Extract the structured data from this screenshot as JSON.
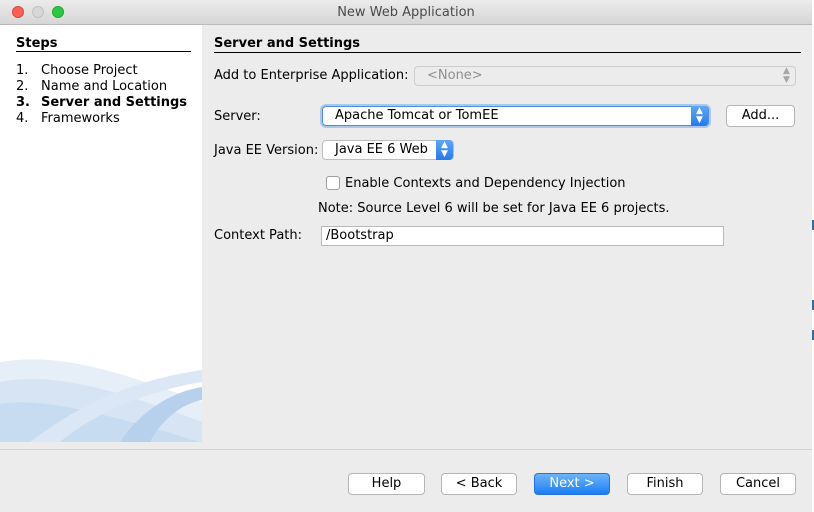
{
  "window": {
    "title": "New Web Application"
  },
  "steps": {
    "heading": "Steps",
    "items": [
      {
        "num": "1.",
        "label": "Choose Project",
        "active": false
      },
      {
        "num": "2.",
        "label": "Name and Location",
        "active": false
      },
      {
        "num": "3.",
        "label": "Server and Settings",
        "active": true
      },
      {
        "num": "4.",
        "label": "Frameworks",
        "active": false
      }
    ]
  },
  "panel": {
    "heading": "Server and Settings",
    "enterprise_label": "Add to Enterprise Application:",
    "enterprise_value": "<None>",
    "server_label": "Server:",
    "server_value": "Apache Tomcat or TomEE",
    "add_button": "Add...",
    "javaee_label": "Java EE Version:",
    "javaee_value": "Java EE 6 Web",
    "cdi_label": "Enable Contexts and Dependency Injection",
    "cdi_checked": false,
    "note": "Note: Source Level 6 will be set for Java EE 6 projects.",
    "context_label": "Context Path:",
    "context_value": "/Bootstrap"
  },
  "buttons": {
    "help": "Help",
    "back": "< Back",
    "next": "Next >",
    "finish": "Finish",
    "cancel": "Cancel"
  },
  "colors": {
    "accent": "#2479f0",
    "close": "#fd5f57",
    "maximize": "#2ac940"
  }
}
